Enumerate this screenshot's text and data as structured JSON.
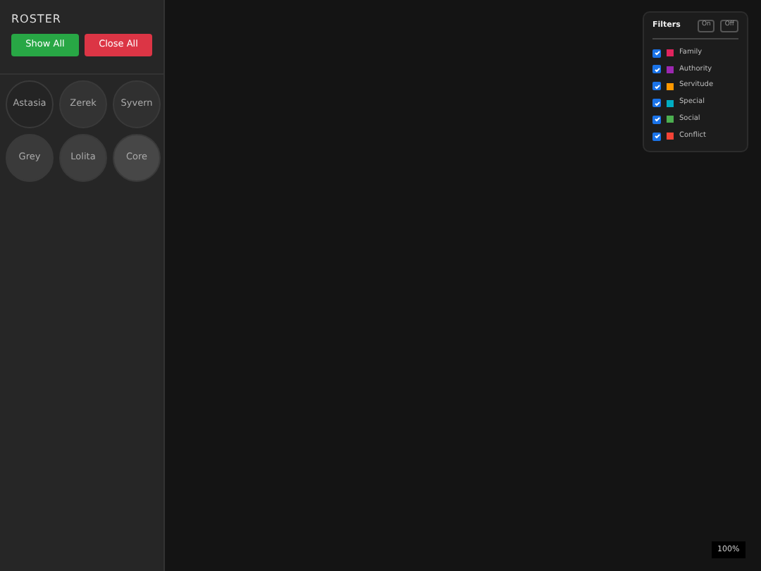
{
  "sidebar": {
    "title": "ROSTER",
    "buttons": [
      {
        "label": "Show All",
        "kind": "success"
      },
      {
        "label": "Close All",
        "kind": "danger"
      }
    ],
    "nodes": [
      {
        "label": "Astasia",
        "color": "#242424"
      },
      {
        "label": "Zerek",
        "color": "#333333"
      },
      {
        "label": "Syvern",
        "color": "#303030"
      },
      {
        "label": "Grey",
        "color": "#3a3a3a"
      },
      {
        "label": "Lolita",
        "color": "#3e3e3e"
      },
      {
        "label": "Core",
        "color": "#474747"
      }
    ]
  },
  "filters": {
    "title": "Filters",
    "toggles": [
      "On",
      "Off"
    ],
    "items": [
      {
        "label": "Family",
        "checked": true,
        "color": "#e0245e"
      },
      {
        "label": "Authority",
        "checked": true,
        "color": "#9c27b0"
      },
      {
        "label": "Servitude",
        "checked": true,
        "color": "#ff9800"
      },
      {
        "label": "Special",
        "checked": true,
        "color": "#00acc1"
      },
      {
        "label": "Social",
        "checked": true,
        "color": "#4caf50"
      },
      {
        "label": "Conflict",
        "checked": true,
        "color": "#f44336"
      }
    ]
  },
  "zoom": "100%"
}
